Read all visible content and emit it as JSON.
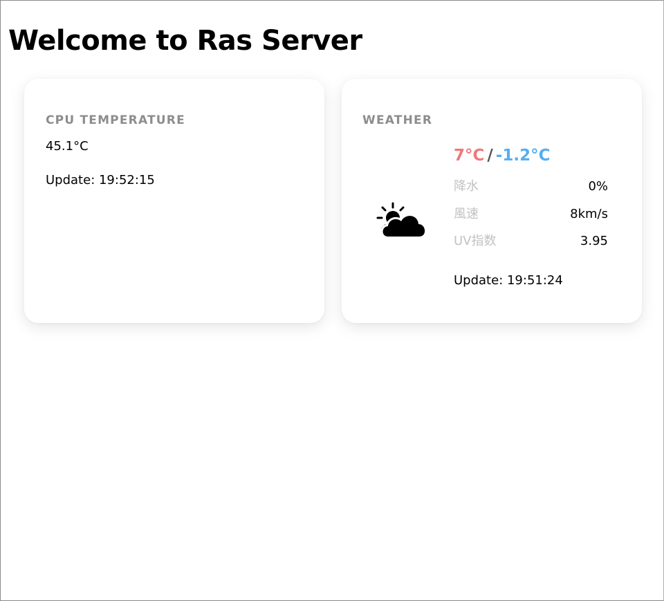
{
  "page": {
    "title": "Welcome to Ras Server"
  },
  "cpu_card": {
    "title": "CPU TEMPERATURE",
    "temperature": "45.1°C",
    "update": "Update: 19:52:15"
  },
  "weather_card": {
    "title": "WEATHER",
    "icon": "partly-cloudy-icon",
    "temp_high": "7°C",
    "separator": "/",
    "temp_low": "-1.2°C",
    "stats": [
      {
        "label": "降水",
        "value": "0%"
      },
      {
        "label": "風速",
        "value": "8km/s"
      },
      {
        "label": "UV指数",
        "value": "3.95"
      }
    ],
    "update": "Update: 19:51:24"
  },
  "colors": {
    "temp_high": "#f07878",
    "temp_low": "#55aef0",
    "label_gray": "#8d8d8d",
    "stat_label": "#c2c2c2"
  }
}
